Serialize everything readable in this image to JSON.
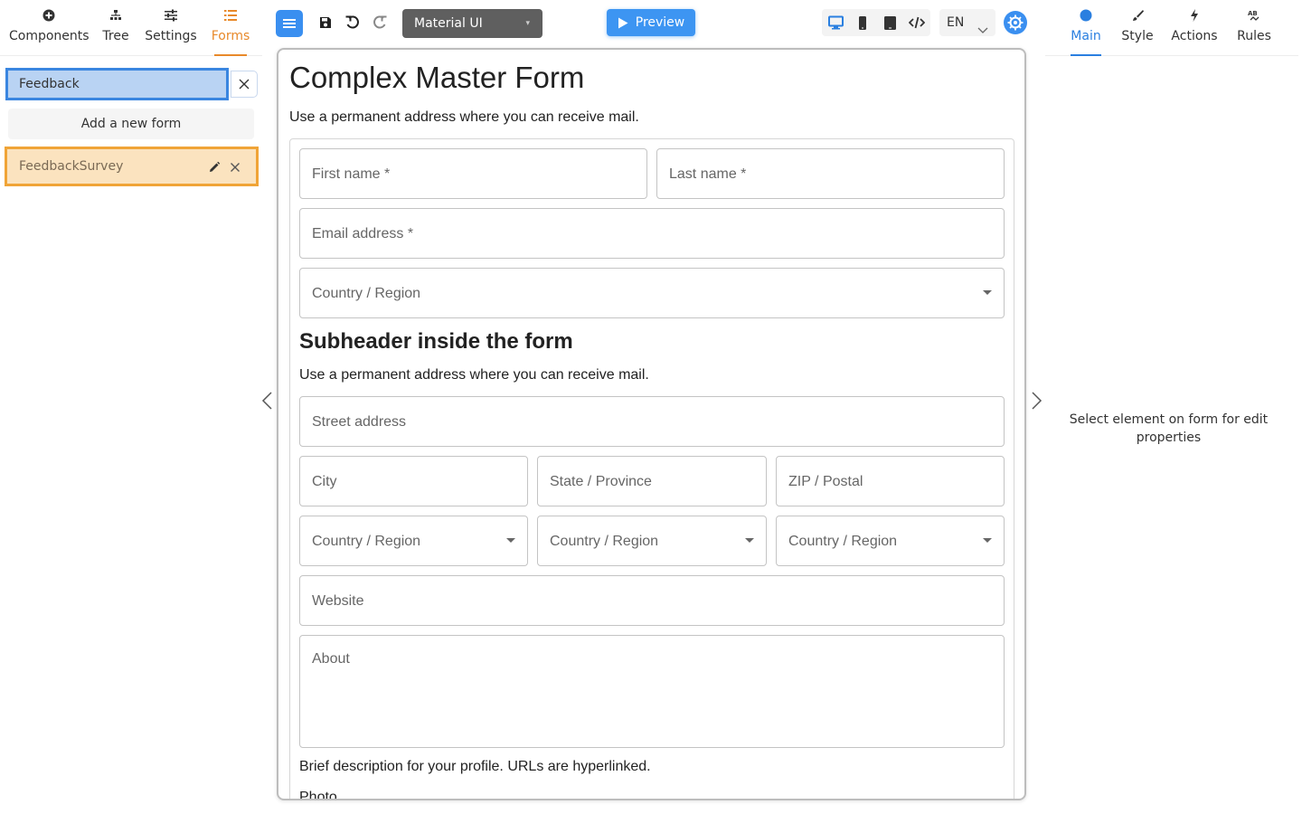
{
  "left_tabs": [
    {
      "label": "Components",
      "icon": "plus-circle-icon"
    },
    {
      "label": "Tree",
      "icon": "tree-icon"
    },
    {
      "label": "Settings",
      "icon": "sliders-icon"
    },
    {
      "label": "Forms",
      "icon": "list-icon"
    }
  ],
  "active_left_tab": "Forms",
  "search": {
    "value": "Feedback"
  },
  "add_form_label": "Add a new form",
  "forms_list": [
    {
      "name": "FeedbackSurvey",
      "selected": true
    }
  ],
  "toolbar": {
    "theme": "Material UI",
    "preview_label": "Preview",
    "language": "EN"
  },
  "form": {
    "title": "Complex Master Form",
    "description": "Use a permanent address where you can receive mail.",
    "first_name": "First name *",
    "last_name": "Last name *",
    "email": "Email address *",
    "country": "Country / Region",
    "subheader": "Subheader inside the form",
    "sub_description": "Use a permanent address where you can receive mail.",
    "street": "Street address",
    "city": "City",
    "state": "State / Province",
    "zip": "ZIP / Postal",
    "country_1": "Country / Region",
    "country_2": "Country / Region",
    "country_3": "Country / Region",
    "website": "Website",
    "about": "About",
    "about_helper": "Brief description for your profile. URLs are hyperlinked.",
    "photo_label": "Photo"
  },
  "right_tabs": [
    {
      "label": "Main",
      "icon": "circle-icon"
    },
    {
      "label": "Style",
      "icon": "brush-icon"
    },
    {
      "label": "Actions",
      "icon": "bolt-icon"
    },
    {
      "label": "Rules",
      "icon": "ab-icon"
    }
  ],
  "active_right_tab": "Main",
  "right_hint": "Select element on form for edit properties",
  "colors": {
    "accent_blue": "#3a8ff0",
    "accent_orange": "#e8892a",
    "selected_bg": "#fbe3bf"
  }
}
